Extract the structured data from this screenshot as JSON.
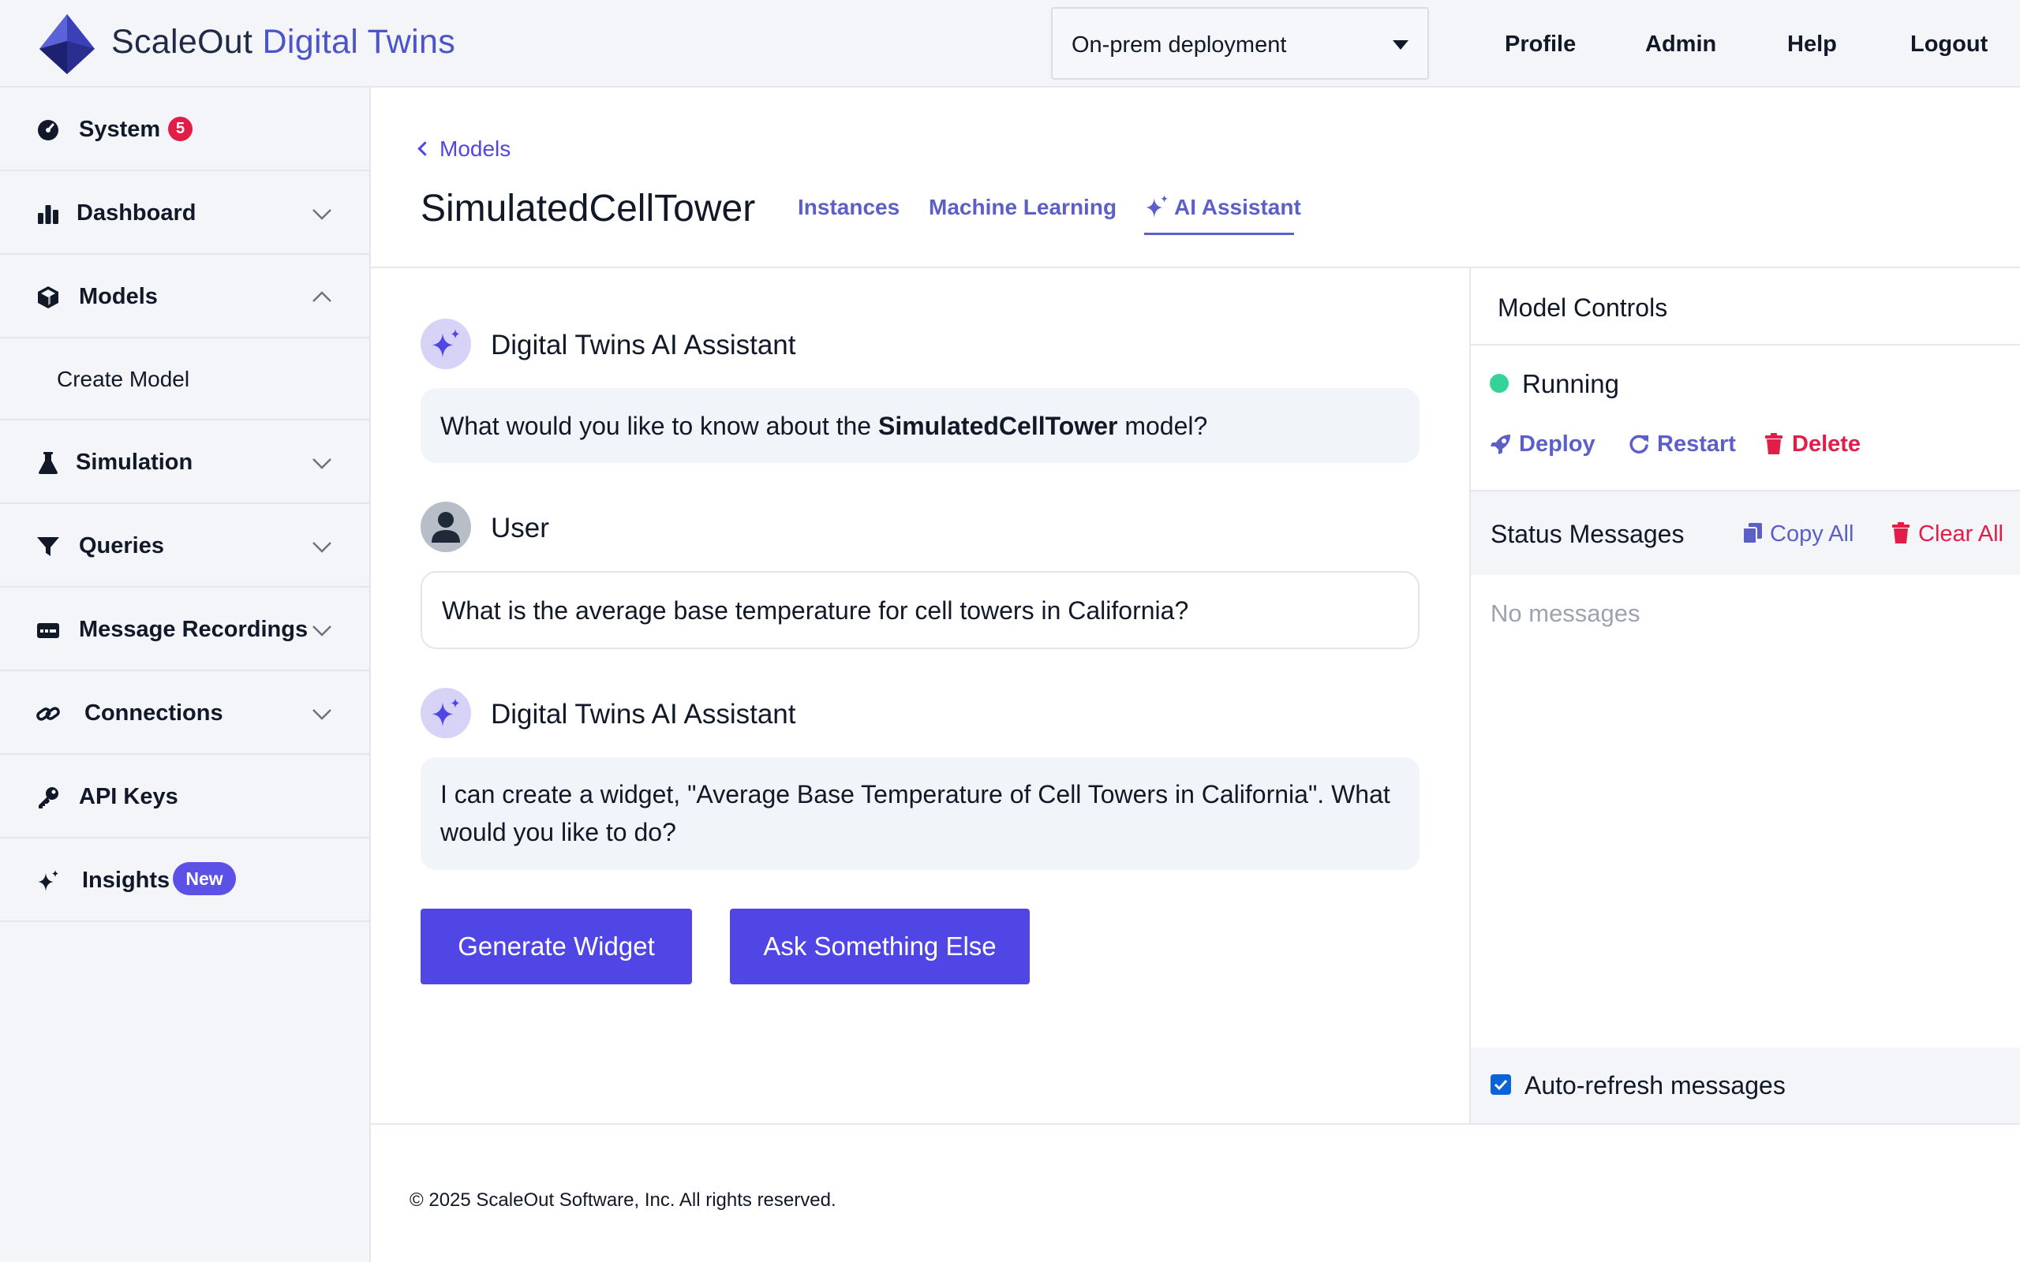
{
  "header": {
    "brand_primary": "ScaleOut",
    "brand_accent": "Digital Twins",
    "deployment_value": "On-prem deployment",
    "nav": [
      "Profile",
      "Admin",
      "Help",
      "Logout"
    ]
  },
  "sidebar": {
    "items": [
      {
        "label": "System",
        "icon": "gauge-icon",
        "badge": "5"
      },
      {
        "label": "Dashboard",
        "icon": "bar-chart-icon"
      },
      {
        "label": "Models",
        "icon": "cube-icon",
        "expanded": true
      },
      {
        "label": "Create Model"
      },
      {
        "label": "Simulation",
        "icon": "flask-icon"
      },
      {
        "label": "Queries",
        "icon": "filter-icon"
      },
      {
        "label": "Message Recordings",
        "icon": "message-recording-icon"
      },
      {
        "label": "Connections",
        "icon": "link-icon"
      },
      {
        "label": "API Keys",
        "icon": "key-icon"
      },
      {
        "label": "Insights",
        "icon": "sparkle-icon",
        "badge": "New"
      }
    ]
  },
  "page": {
    "back_link": "Models",
    "title": "SimulatedCellTower",
    "tabs": [
      {
        "label": "Instances",
        "active": false
      },
      {
        "label": "Machine Learning",
        "active": false
      },
      {
        "label": "AI Assistant",
        "active": true
      }
    ]
  },
  "chat": {
    "assistant_name": "Digital Twins AI Assistant",
    "user_name": "User",
    "msg1_before": "What would you like to know about the ",
    "msg1_bold": "SimulatedCellTower",
    "msg1_after": " model?",
    "msg2": "What is the average base temperature for cell towers in California?",
    "msg3": "I can create a widget, \"Average Base Temperature of Cell Towers in California\". What would you like to do?",
    "buttons": {
      "generate": "Generate Widget",
      "ask": "Ask Something Else"
    }
  },
  "controls": {
    "title": "Model Controls",
    "status": "Running",
    "status_color": "#34d399",
    "actions": {
      "deploy": "Deploy",
      "restart": "Restart",
      "delete": "Delete"
    },
    "status_messages_title": "Status Messages",
    "copy_all": "Copy All",
    "clear_all": "Clear All",
    "no_messages": "No messages",
    "auto_refresh_label": "Auto-refresh messages",
    "auto_refresh_checked": true
  },
  "footer": {
    "text": "© 2025 ScaleOut Software, Inc. All rights reserved."
  },
  "colors": {
    "accent": "#4f46e5",
    "danger": "#e11d48",
    "link": "#5b5fc7"
  }
}
